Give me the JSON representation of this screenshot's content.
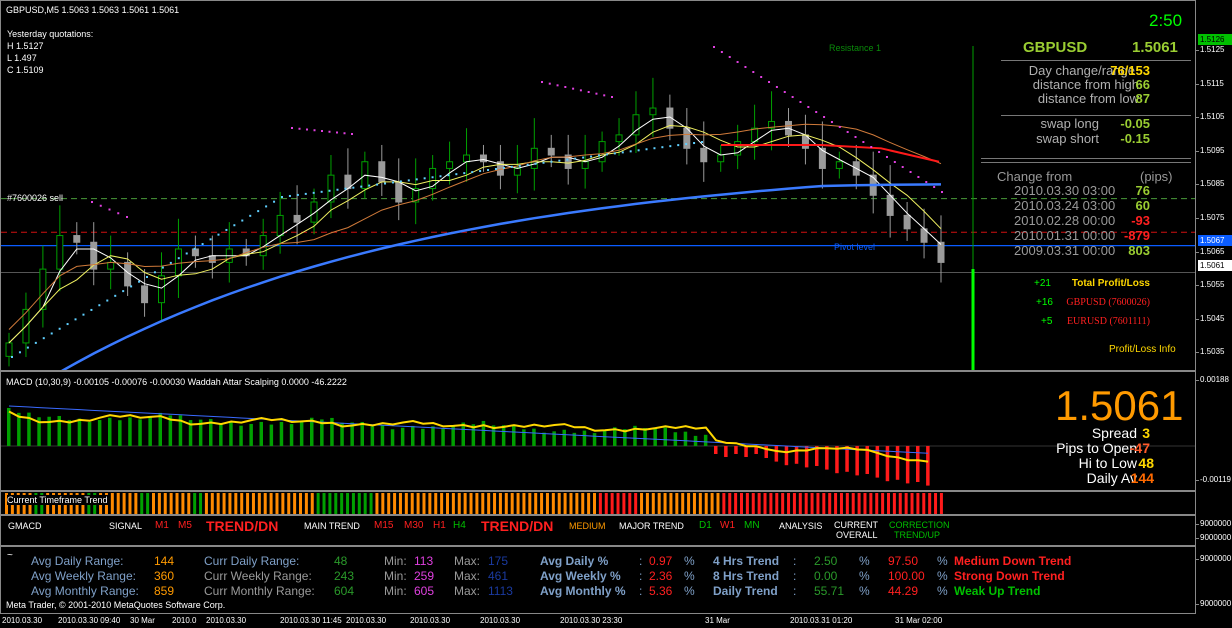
{
  "colors": {
    "up": "#00c000",
    "down": "#ff2020",
    "yellow": "#ffd800",
    "orange": "#ff8a00",
    "lime": "#00ff00",
    "gray": "#b0b0b0",
    "blue": "#0a5cff",
    "magenta": "#e040e0",
    "cyan": "#60d0ff"
  },
  "chart": {
    "header": "GBPUSD,M5  1.5063 1.5063 1.5061 1.5061",
    "yesterday": {
      "title": "Yesterday quotations:",
      "h": "H 1.5127",
      "l": "L 1.497",
      "c": "C 1.5109"
    },
    "order_label": "#7600026 sell",
    "resistance_label": "Resistance 1",
    "pivot_label": "Pivot level",
    "clock": "2:50",
    "price_ticks": [
      "1.5125",
      "1.5115",
      "1.5105",
      "1.5095",
      "1.5085",
      "1.5075",
      "1.5065",
      "1.5055",
      "1.5045",
      "1.5035"
    ],
    "price_tags": {
      "top": "1.5126",
      "pivot": "1.5067",
      "current": "1.5061"
    },
    "series": [
      1.5038,
      1.5048,
      1.506,
      1.507,
      1.5068,
      1.506,
      1.5062,
      1.5055,
      1.505,
      1.5058,
      1.5066,
      1.5064,
      1.5062,
      1.5066,
      1.5064,
      1.507,
      1.5076,
      1.5074,
      1.508,
      1.5088,
      1.5084,
      1.5092,
      1.5086,
      1.508,
      1.5084,
      1.509,
      1.5092,
      1.5094,
      1.5092,
      1.5088,
      1.509,
      1.5096,
      1.5094,
      1.509,
      1.5092,
      1.5098,
      1.51,
      1.5106,
      1.5108,
      1.5102,
      1.5096,
      1.5092,
      1.5094,
      1.5098,
      1.5102,
      1.5104,
      1.51,
      1.5096,
      1.509,
      1.5092,
      1.5088,
      1.5082,
      1.5076,
      1.5072,
      1.5068,
      1.5062
    ]
  },
  "dashboard": {
    "symbol": "GBPUSD",
    "price": "1.5061",
    "rows": [
      {
        "label": "Day change/range",
        "value": "76/153"
      },
      {
        "label": "distance from high",
        "value": "66"
      },
      {
        "label": "distance from low",
        "value": "87"
      }
    ],
    "swap_long": {
      "label": "swap long",
      "value": "-0.05"
    },
    "swap_short": {
      "label": "swap short",
      "value": "-0.15"
    },
    "change_from": {
      "label": "Change from",
      "unit": "(pips)"
    },
    "changes": [
      {
        "date": "2010.03.30 03:00",
        "value": "76",
        "color": "#9acd32"
      },
      {
        "date": "2010.03.24 03:00",
        "value": "60",
        "color": "#9acd32"
      },
      {
        "date": "2010.02.28 00:00",
        "value": "-93",
        "color": "#ff2020"
      },
      {
        "date": "2010.01.31 00:00",
        "value": "-879",
        "color": "#ff2020"
      },
      {
        "date": "2009.03.31 00:00",
        "value": "803",
        "color": "#9acd32"
      }
    ],
    "pl": [
      {
        "amount": "+21",
        "label": "Total Profit/Loss",
        "color": "#ffd800"
      },
      {
        "amount": "+16",
        "label": "GBPUSD (7600026)",
        "color": "#ff2020"
      },
      {
        "amount": "+5",
        "label": "EURUSD (7601111)",
        "color": "#ff2020"
      }
    ],
    "pl_info": "Profit/Loss Info"
  },
  "macd": {
    "header": "MACD (10,30,9) -0.00105 -0.00076 -0.00030  Waddah Attar Scalping 0.0000 -46.2222",
    "ticks": {
      "top": "0.00188",
      "bottom": "-0.00119"
    },
    "big_price": "1.5061",
    "info": [
      {
        "label": "Spread",
        "value": "3"
      },
      {
        "label": "Pips to Open",
        "value": "-47"
      },
      {
        "label": "Hi to Low",
        "value": "48"
      },
      {
        "label": "Daily Av",
        "value": "144"
      }
    ]
  },
  "trend": {
    "header": "Current Timeframe Trend"
  },
  "gmacd": {
    "title": "GMACD",
    "signal": "SIGNAL",
    "m1": "M1",
    "m5": "M5",
    "trend_dn": "TREND/DN",
    "main_trend": "MAIN TREND",
    "m15": "M15",
    "m30": "M30",
    "h1": "H1",
    "h4": "H4",
    "trend_dn2": "TREND/DN",
    "medium": "MEDIUM",
    "major": "MAJOR TREND",
    "d1": "D1",
    "w1": "W1",
    "mn": "MN",
    "analysis": "ANALYSIS",
    "current": "CURRENT",
    "overall": "OVERALL",
    "correction": "CORRECTION",
    "trend_up": "TREND/UP",
    "tick": "9000000"
  },
  "stats": {
    "tilde": "~",
    "avg": [
      {
        "label": "Avg Daily Range:",
        "value": "144"
      },
      {
        "label": "Avg Weekly Range:",
        "value": "360"
      },
      {
        "label": "Avg Monthly Range:",
        "value": "859"
      }
    ],
    "curr": [
      {
        "label": "Curr Daily Range:",
        "value": "48",
        "min": "113",
        "max": "175"
      },
      {
        "label": "Curr Weekly Range:",
        "value": "243",
        "min": "259",
        "max": "461"
      },
      {
        "label": "Curr Monthly Range:",
        "value": "604",
        "min": "605",
        "max": "1113"
      }
    ],
    "min_label": "Min:",
    "max_label": "Max:",
    "pct": [
      {
        "label": "Avg Daily %",
        "colon": ":",
        "value": "0.97",
        "unit": "%"
      },
      {
        "label": "Avg Weekly %",
        "colon": ":",
        "value": "2.36",
        "unit": "%"
      },
      {
        "label": "Avg Monthly %",
        "colon": ":",
        "value": "5.36",
        "unit": "%"
      }
    ],
    "trend_rows": [
      {
        "label": "4 Hrs Trend",
        "colon": ":",
        "a": "2.50",
        "pct": "%",
        "b": "97.50",
        "pct2": "%",
        "text": "Medium Down Trend",
        "color": "#ff2020"
      },
      {
        "label": "8 Hrs Trend",
        "colon": ":",
        "a": "0.00",
        "pct": "%",
        "b": "100.00",
        "pct2": "%",
        "text": "Strong Down Trend",
        "color": "#ff2020"
      },
      {
        "label": "Daily Trend",
        "colon": ":",
        "a": "55.71",
        "pct": "%",
        "b": "44.29",
        "pct2": "%",
        "text": "Weak Up Trend",
        "color": "#00c000"
      }
    ],
    "copyright": "Meta Trader, © 2001-2010 MetaQuotes Software Corp.",
    "ticks": [
      "9000000",
      "9000000"
    ]
  },
  "time_axis": [
    "2010.03.30",
    "2010.03.30 09:40",
    "30 Mar",
    "2010.0",
    "2010.03.30",
    "2010.03.30 11:45",
    "2010.03.30",
    "2010.03.30",
    "2010.03.30",
    "2010.03.30 23:30",
    "31 Mar",
    "2010.03.31 01:20",
    "31 Mar 02:00"
  ]
}
